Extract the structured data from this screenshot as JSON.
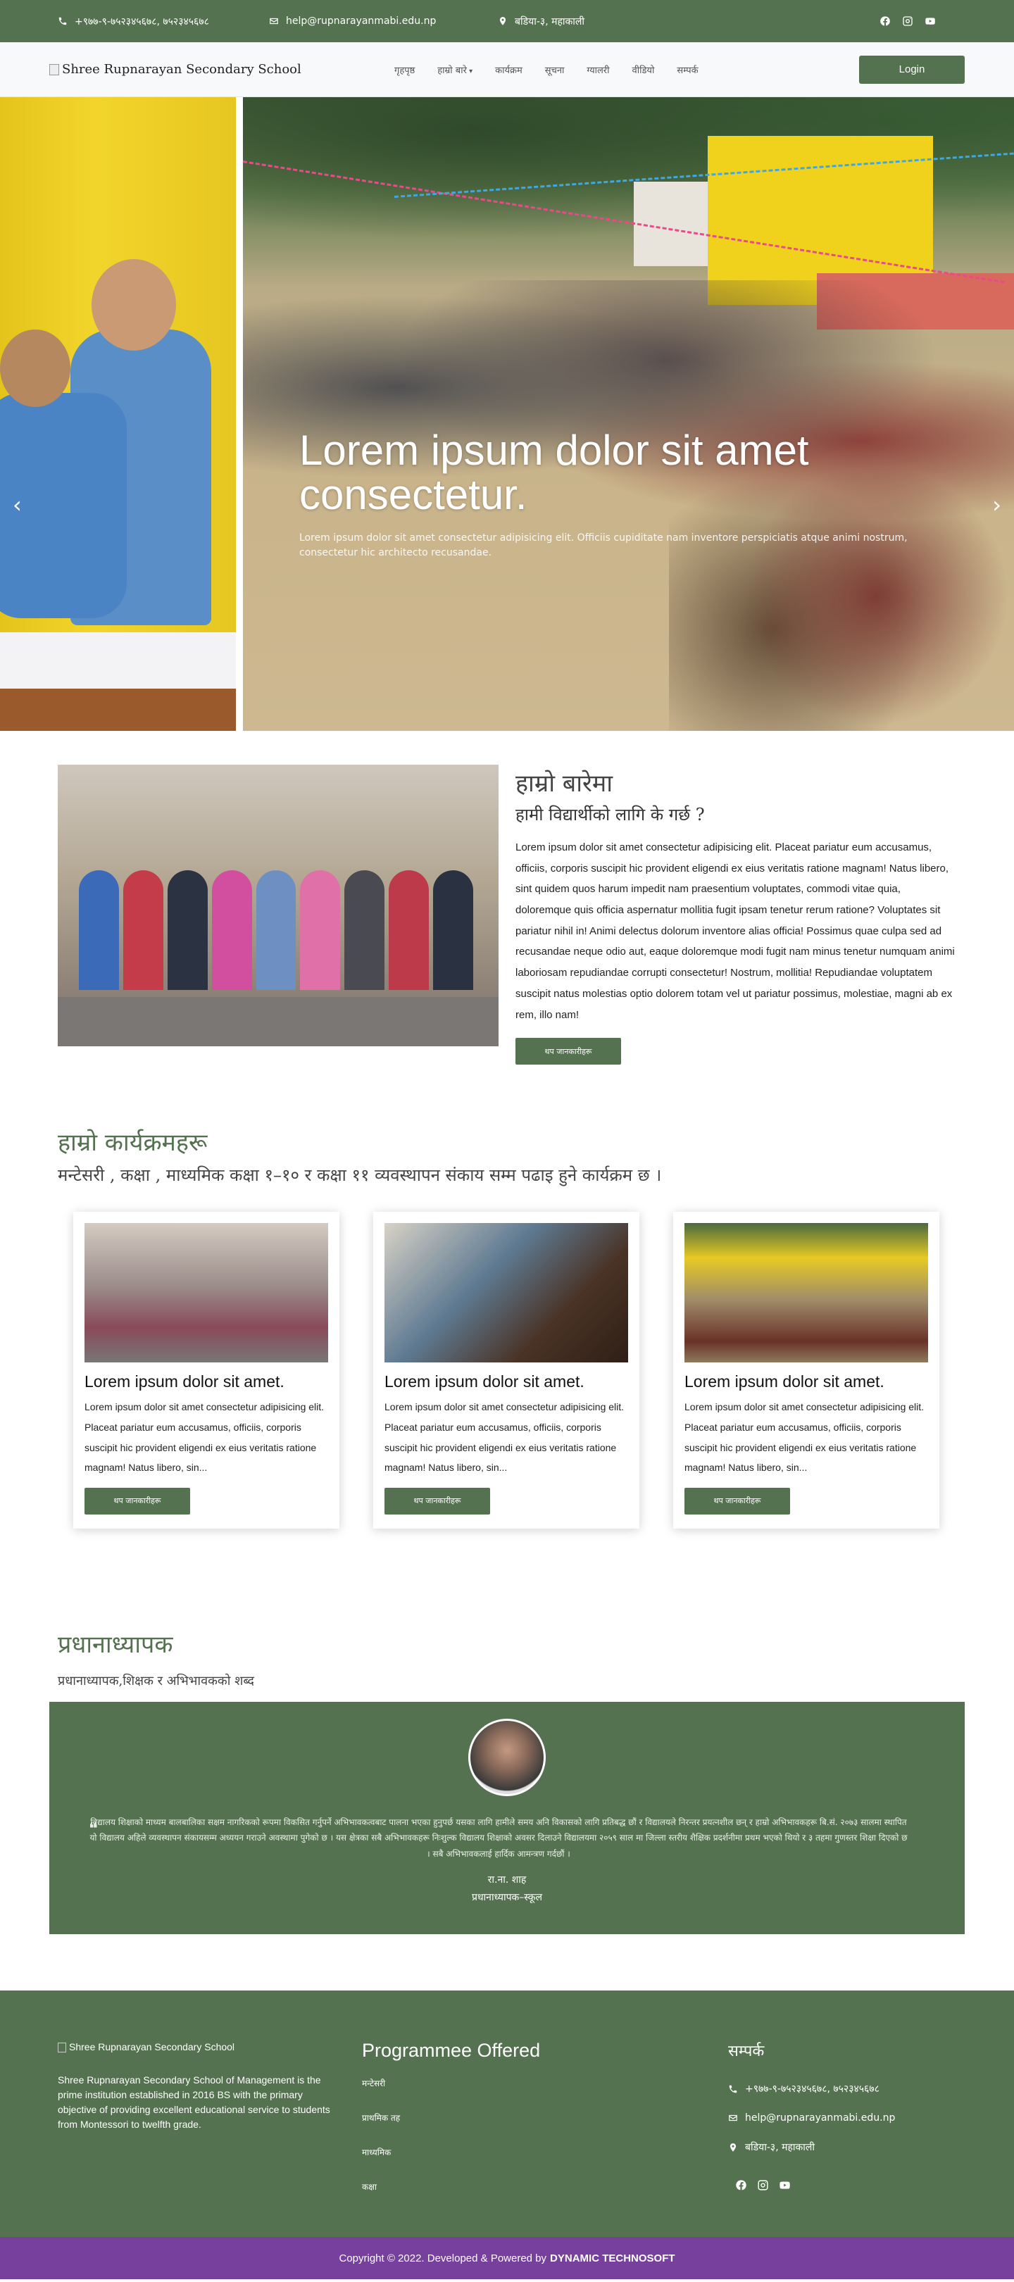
{
  "topbar": {
    "phone": "+९७७-९-७५२३४५६७८, ७५२३४५६७८",
    "email": "help@rupnarayanmabi.edu.np",
    "address": "बडिया-३, महाकाली"
  },
  "nav": {
    "logo_alt": "Shree Rupnarayan Secondary School",
    "items": [
      "गृहपृष्ठ",
      "हाम्रो बारे",
      "कार्यक्रम",
      "सूचना",
      "ग्यालरी",
      "वीडियो",
      "सम्पर्क"
    ],
    "login": "Login"
  },
  "hero": {
    "title": "Lorem ipsum dolor sit amet consectetur.",
    "text": "Lorem ipsum dolor sit amet consectetur adipisicing elit. Officiis cupiditate nam inventore perspiciatis atque animi nostrum, consectetur hic architecto recusandae.",
    "prev": "‹",
    "next": "›"
  },
  "about": {
    "title": "हाम्रो बारेमा",
    "subtitle": "हामी विद्यार्थीको लागि के गर्छ ?",
    "text": "Lorem ipsum dolor sit amet consectetur adipisicing elit. Placeat pariatur eum accusamus, officiis, corporis suscipit hic provident eligendi ex eius veritatis ratione magnam! Natus libero, sint quidem quos harum impedit nam praesentium voluptates, commodi vitae quia, doloremque quis officia aspernatur mollitia fugit ipsam tenetur rerum ratione? Voluptates sit pariatur nihil in! Animi delectus dolorum inventore alias officia! Possimus quae culpa sed ad recusandae neque odio aut, eaque doloremque modi fugit nam minus tenetur numquam animi laboriosam repudiandae corrupti consectetur! Nostrum, mollitia! Repudiandae voluptatem suscipit natus molestias optio dolorem totam vel ut pariatur possimus, molestiae, magni ab ex rem, illo nam!",
    "button": "थप जानकारीहरू"
  },
  "programs": {
    "title": "हाम्रो कार्यक्रमहरू",
    "subtitle": "मन्टेसरी , कक्षा , माध्यमिक कक्षा १–१० र कक्षा ११ व्यवस्थापन संकाय सम्म पढाइ हुने कार्यक्रम छ ।",
    "cards": [
      {
        "title": "Lorem ipsum dolor sit amet.",
        "text": "Lorem ipsum dolor sit amet consectetur adipisicing elit. Placeat pariatur eum accusamus, officiis, corporis suscipit hic provident eligendi ex eius veritatis ratione magnam! Natus libero, sin...",
        "button": "थप जानकारीहरू"
      },
      {
        "title": "Lorem ipsum dolor sit amet.",
        "text": "Lorem ipsum dolor sit amet consectetur adipisicing elit. Placeat pariatur eum accusamus, officiis, corporis suscipit hic provident eligendi ex eius veritatis ratione magnam! Natus libero, sin...",
        "button": "थप जानकारीहरू"
      },
      {
        "title": "Lorem ipsum dolor sit amet.",
        "text": "Lorem ipsum dolor sit amet consectetur adipisicing elit. Placeat pariatur eum accusamus, officiis, corporis suscipit hic provident eligendi ex eius veritatis ratione magnam! Natus libero, sin...",
        "button": "थप जानकारीहरू"
      }
    ]
  },
  "testimonial": {
    "title": "प्रधानाध्यापक",
    "subtitle": "प्रधानाध्यापक,शिक्षक र अभिभावकको शब्द",
    "quote": "विद्यालय शिक्षाको माध्यम बालबालिका सक्षम नागरिकको रूपमा विकसित गर्नुपर्ने अभिभावकत्वबाट पालना भएका हुनुपर्छ यसका लागि हामीले समय अनि विकासको लागि प्रतिबद्ध छौं र विद्यालयले निरन्तर प्रयत्नशील छन् र हाम्रो अभिभावकहरू बि.सं. २०७३ सालमा स्थापित यो विद्यालय अहिले व्यवस्थापन संकायसम्म अध्ययन गराउने अवस्थामा पुगेको छ । यस क्षेत्रका सबै अभिभावकहरू निःशुल्क विद्यालय शिक्षाको अवसर दिलाउने विद्यालयमा २०५९ साल मा जिल्ला स्तरीय शैक्षिक प्रदर्शनीमा प्रथम भएको थियो र ३ तहमा गुणस्तर शिक्षा दिएको छ । सबै अभिभावकलाई हार्दिक आमन्त्रण गर्दछौं ।",
    "quote_mark": "❝",
    "name": "रा.ना. शाह",
    "role": "प्रधानाध्यापक–स्कूल"
  },
  "footer": {
    "logo_alt": "Shree Rupnarayan Secondary School",
    "about": "Shree Rupnarayan Secondary School of Management is the prime institution established in 2016 BS with the primary objective of providing excellent educational service to students from Montessori to twelfth grade.",
    "programmes_title": "Programmee Offered",
    "programmes": [
      "मन्टेसरी",
      "प्राथमिक तह",
      "माध्यमिक",
      "कक्षा"
    ],
    "contact_title": "सम्पर्क",
    "phone": "+९७७-९-७५२३४५६७८, ७५२३४५६७८",
    "email": "help@rupnarayanmabi.edu.np",
    "address": "बडिया-३, महाकाली"
  },
  "copyright": {
    "text": "Copyright © 2022. Developed & Powered by",
    "brand": "DYNAMIC TECHNOSOFT"
  },
  "colors": {
    "primary_green": "#557250",
    "footer_purple": "#76409c"
  }
}
